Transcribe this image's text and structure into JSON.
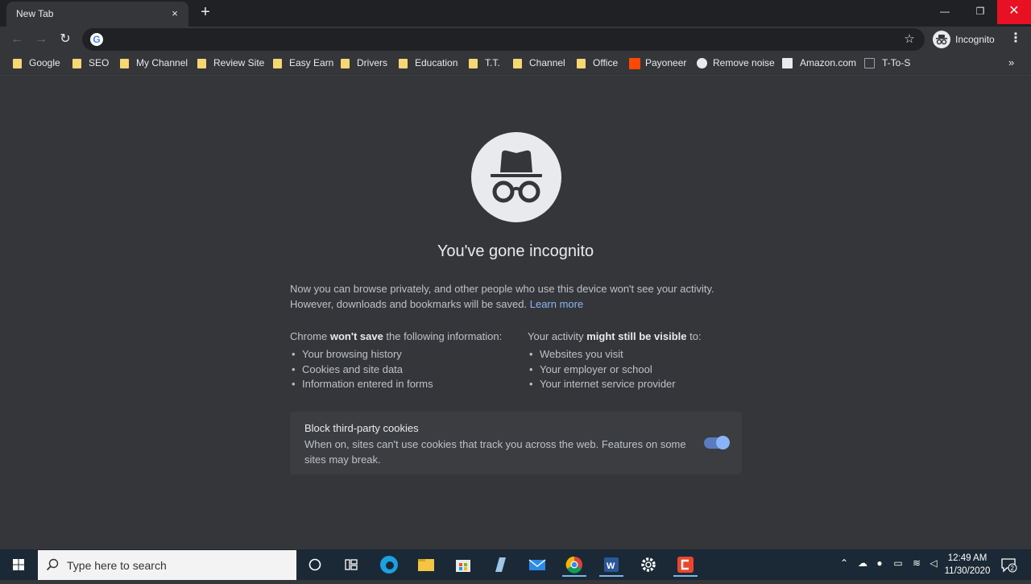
{
  "tab": {
    "title": "New Tab",
    "close_icon": "×",
    "new_tab_icon": "+"
  },
  "window_controls": {
    "minimize": "—",
    "maximize": "❐",
    "close": "✕"
  },
  "toolbar": {
    "back_icon": "←",
    "forward_icon": "→",
    "reload_icon": "↻",
    "omnibox": {
      "value": "",
      "placeholder": ""
    },
    "star_icon": "☆",
    "profile_label": "Incognito",
    "menu_icon": "⋮"
  },
  "bookmarks": [
    {
      "label": "Google",
      "icon": "folder"
    },
    {
      "label": "SEO",
      "icon": "folder"
    },
    {
      "label": "My Channel",
      "icon": "folder"
    },
    {
      "label": "Review Site",
      "icon": "folder"
    },
    {
      "label": "Easy Earn",
      "icon": "folder"
    },
    {
      "label": "Drivers",
      "icon": "folder"
    },
    {
      "label": "Education",
      "icon": "folder"
    },
    {
      "label": "T.T.",
      "icon": "folder"
    },
    {
      "label": "Channel",
      "icon": "folder"
    },
    {
      "label": "Office",
      "icon": "folder"
    },
    {
      "label": "Payoneer",
      "icon": "payoneer"
    },
    {
      "label": "Remove noise",
      "icon": "globe"
    },
    {
      "label": "Amazon.com",
      "icon": "amazon"
    },
    {
      "label": "T-To-S",
      "icon": "page"
    }
  ],
  "bookmarks_more_icon": "»",
  "page": {
    "heading": "You've gone incognito",
    "intro_line1": "Now you can browse privately, and other people who use this device won't see your activity.",
    "intro_line2": "However, downloads and bookmarks will be saved.",
    "learn_more": "Learn more",
    "left_prefix": "Chrome ",
    "left_bold": "won't save",
    "left_suffix": " the following information:",
    "left_items": [
      "Your browsing history",
      "Cookies and site data",
      "Information entered in forms"
    ],
    "right_prefix": "Your activity ",
    "right_bold": "might still be visible",
    "right_suffix": " to:",
    "right_items": [
      "Websites you visit",
      "Your employer or school",
      "Your internet service provider"
    ],
    "cookie_title": "Block third-party cookies",
    "cookie_desc": "When on, sites can't use cookies that track you across the web. Features on some sites may break.",
    "cookie_toggle_on": true
  },
  "taskbar": {
    "search_placeholder": "Type here to search",
    "clock_time": "12:49 AM",
    "clock_date": "11/30/2020",
    "notification_count": "2"
  }
}
